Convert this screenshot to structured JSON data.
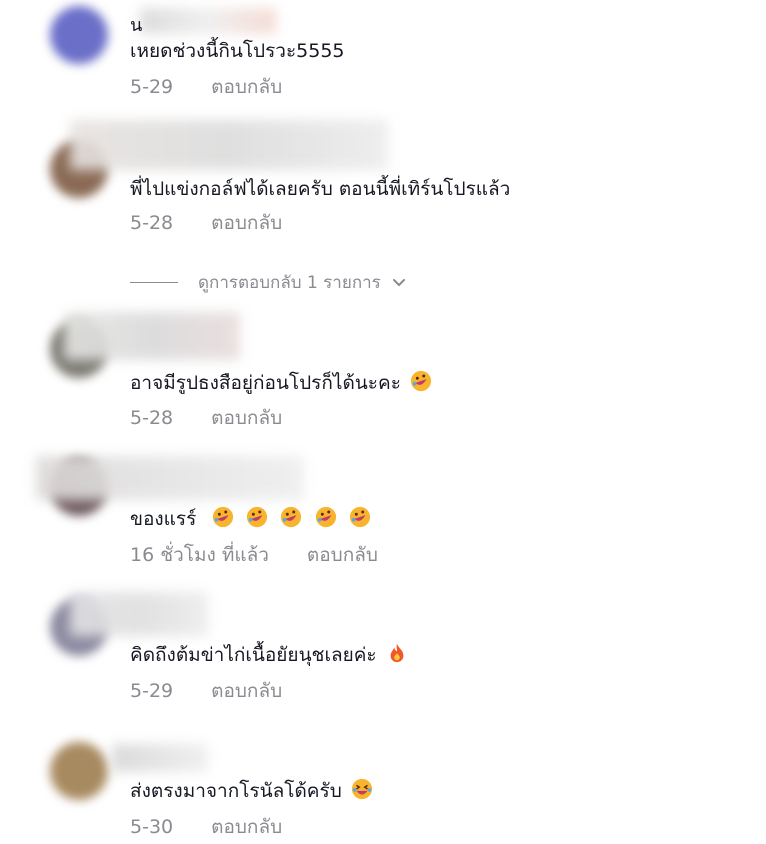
{
  "comments": [
    {
      "username": "น",
      "text": "เหยดช่วงนี้กินโปรวะ5555",
      "date": "5-29",
      "reply_label": "ตอบกลับ",
      "avatar_color": "#6b6fc8"
    },
    {
      "username": "",
      "text": "พี่ไปแข่งกอล์ฟได้เลยครับ ตอนนี้พี่เทิร์นโปรแล้ว",
      "date": "5-28",
      "reply_label": "ตอบกลับ",
      "avatar_color": "#8a6a55"
    },
    {
      "username": "",
      "text": "อาจมีรูปธงสือยู่ก่อนโปรก็ได้นะคะ",
      "date": "5-28",
      "reply_label": "ตอบกลับ",
      "avatar_color": "#7c7a72",
      "emoji": "rolling-on-floor-laughing"
    },
    {
      "username": "",
      "text": "ของแรร์",
      "date": "16 ชั่วโมง ที่แล้ว",
      "reply_label": "ตอบกลับ",
      "avatar_color": "#6e5a5e",
      "emoji": "rolling-on-floor-laughing",
      "emoji_count": 5
    },
    {
      "username": "",
      "text": "คิดถึงต้มข่าไก่เนื้อยัยนุชเลยค่ะ",
      "date": "5-29",
      "reply_label": "ตอบกลับ",
      "avatar_color": "#8c8aa0",
      "emoji": "fire"
    },
    {
      "username": "",
      "text": "ส่งตรงมาจากโรนัลโด้ครับ",
      "date": "5-30",
      "reply_label": "ตอบกลับ",
      "avatar_color": "#a88a60",
      "emoji": "grinning-squinting"
    }
  ],
  "view_replies": {
    "label": "ดูการตอบกลับ 1 รายการ",
    "icon": "chevron-down-icon"
  },
  "colors": {
    "text": "#161823",
    "meta": "#8a8b91",
    "background": "#ffffff"
  }
}
